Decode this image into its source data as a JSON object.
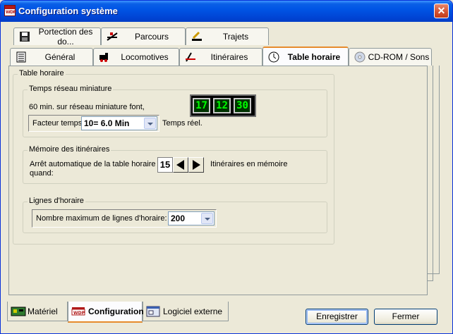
{
  "window": {
    "title": "Configuration système",
    "close_glyph": "✕",
    "app_icon_text": "WDP"
  },
  "tabs_row1": [
    {
      "label": "Portection des do...",
      "icon": "floppy-disk-icon"
    },
    {
      "label": "Parcours",
      "icon": "switch-track-icon"
    },
    {
      "label": "Trajets",
      "icon": "route-edit-icon"
    }
  ],
  "tabs_row2": [
    {
      "label": "Général",
      "icon": "list-icon"
    },
    {
      "label": "Locomotives",
      "icon": "locomotive-icon"
    },
    {
      "label": "Itinéraires",
      "icon": "itinerary-icon"
    },
    {
      "label": "Table horaire",
      "icon": "clock-icon",
      "active": true
    },
    {
      "label": "CD-ROM / Sons",
      "icon": "cd-rom-icon"
    }
  ],
  "panel": {
    "outer_legend": "Table horaire",
    "model_time": {
      "legend": "Temps réseau miniature",
      "line1": "60 min. sur réseau miniature font,",
      "factor_label": "Facteur temps:",
      "factor_value": "10= 6.0 Min",
      "suffix": "Temps réel.",
      "clock": [
        "17",
        "12",
        "30"
      ]
    },
    "memory": {
      "legend": "Mémoire des itinéraires",
      "label_line1": "Arrêt automatique de la table horaire",
      "label_line2": "quand:",
      "value": "15",
      "suffix": "Itinéraires en mémoire"
    },
    "lines": {
      "legend": "Lignes d'horaire",
      "label": "Nombre maximum de lignes d'horaire:",
      "value": "200"
    }
  },
  "bottom_tabs": [
    {
      "label": "Matériel",
      "icon": "hardware-board-icon"
    },
    {
      "label": "Configuration",
      "icon": "wdp-config-icon",
      "active": true
    },
    {
      "label": "Logiciel externe",
      "icon": "external-software-icon"
    }
  ],
  "buttons": {
    "save": "Enregistrer",
    "close": "Fermer"
  }
}
